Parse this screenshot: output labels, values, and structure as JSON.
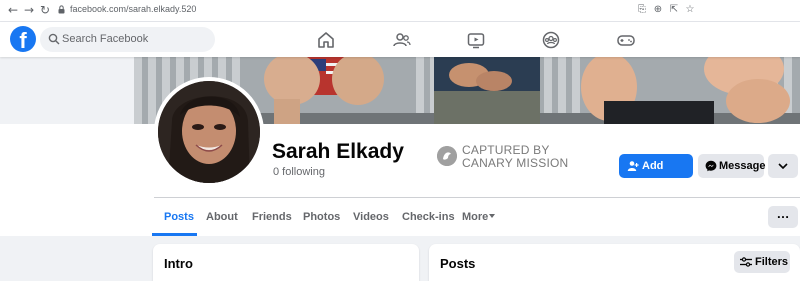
{
  "browser": {
    "url": "facebook.com/sarah.elkady.520",
    "icons": [
      "back-arrow-icon",
      "forward-arrow-icon",
      "reload-icon",
      "lock-icon",
      "save-page-icon",
      "zoom-icon",
      "share-icon",
      "bookmark-star-icon"
    ]
  },
  "header": {
    "logo": "f",
    "search_placeholder": "Search Facebook",
    "nav_icons": [
      "home-icon",
      "friends-icon",
      "watch-icon",
      "groups-icon",
      "gaming-icon"
    ],
    "accent_color": "#1877f2"
  },
  "profile": {
    "name": "Sarah Elkady",
    "following": "0 following"
  },
  "stamp": {
    "line1": "CAPTURED BY",
    "line2": "CANARY MISSION"
  },
  "actions": {
    "add_friend": "Add friend",
    "message": "Message"
  },
  "tabs": [
    {
      "label": "Posts",
      "active": true
    },
    {
      "label": "About"
    },
    {
      "label": "Friends"
    },
    {
      "label": "Photos"
    },
    {
      "label": "Videos"
    },
    {
      "label": "Check-ins"
    },
    {
      "label": "More"
    }
  ],
  "intro": {
    "title": "Intro"
  },
  "posts": {
    "title": "Posts",
    "filters": "Filters"
  }
}
